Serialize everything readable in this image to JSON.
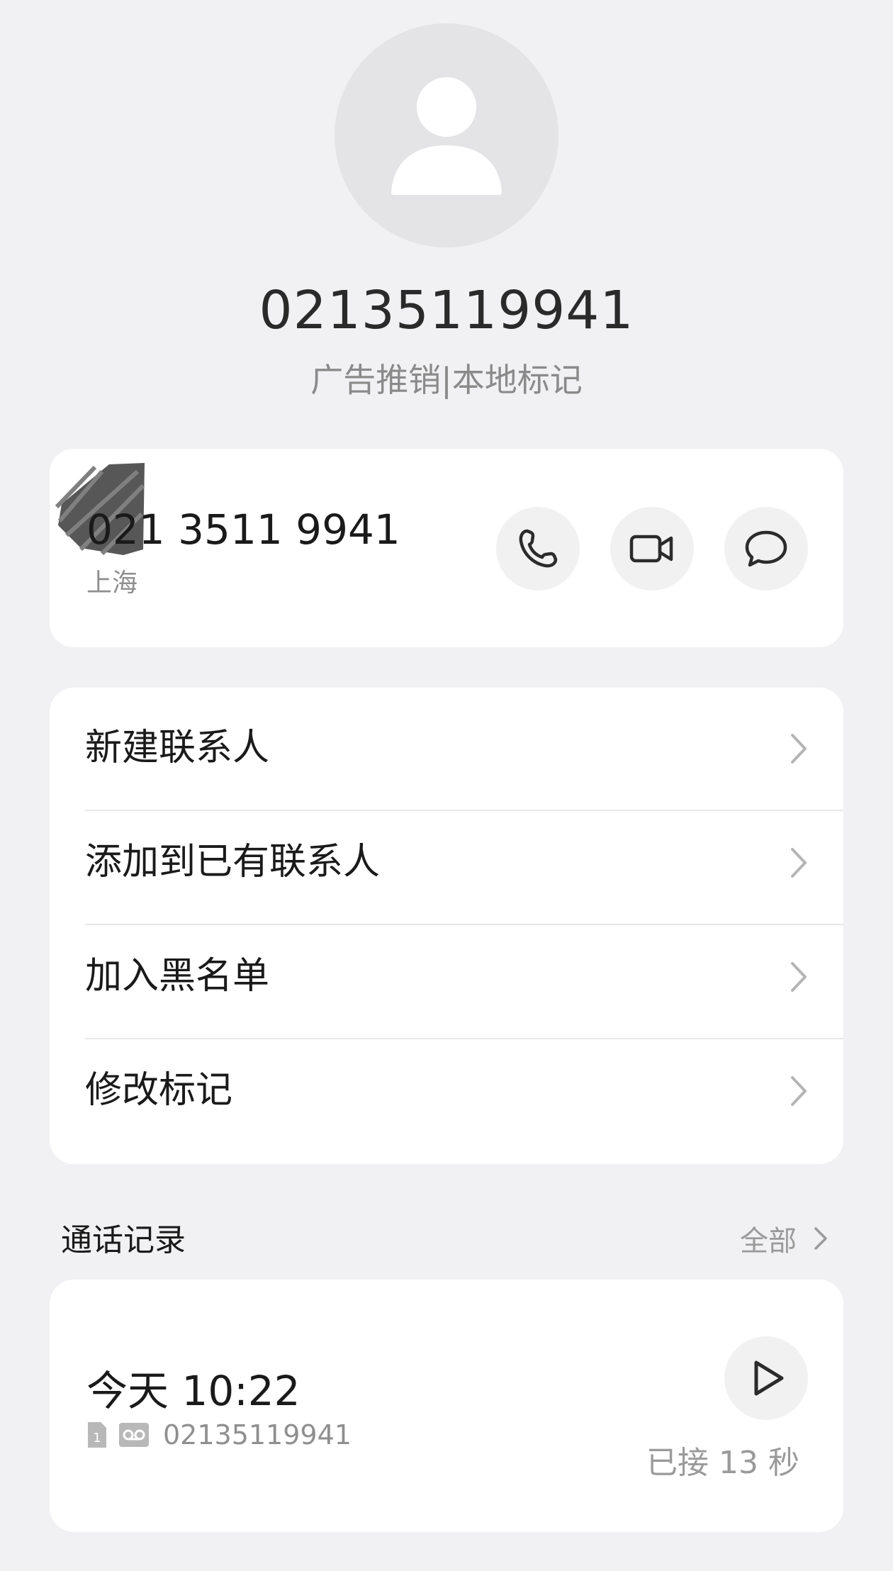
{
  "header": {
    "number": "02135119941",
    "tag": "广告推销|本地标记"
  },
  "number_card": {
    "number": "021 3511 9941",
    "location": "上海",
    "call_icon": "phone-icon",
    "video_icon": "video-camera-icon",
    "message_icon": "message-bubble-icon"
  },
  "actions": [
    {
      "label": "新建联系人"
    },
    {
      "label": "添加到已有联系人"
    },
    {
      "label": "加入黑名单"
    },
    {
      "label": "修改标记"
    }
  ],
  "call_log": {
    "title": "通话记录",
    "all_label": "全部",
    "records": [
      {
        "time": "今天 10:22",
        "sim": "1",
        "number": "02135119941",
        "status": "已接 13 秒"
      }
    ]
  },
  "colors": {
    "background": "#f1f1f3",
    "card": "#ffffff",
    "secondary_text": "#8f8f8f"
  }
}
